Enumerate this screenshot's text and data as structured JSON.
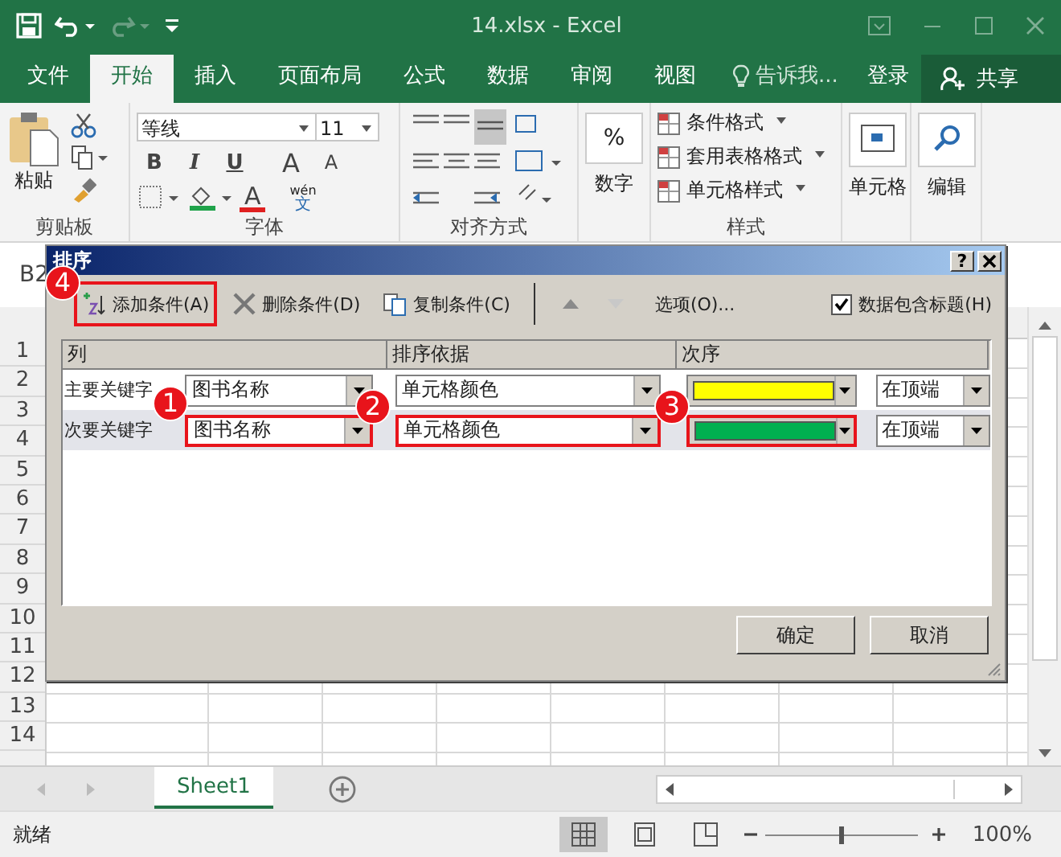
{
  "window": {
    "title": "14.xlsx - Excel"
  },
  "tabs": [
    {
      "label": "文件",
      "selected": false
    },
    {
      "label": "开始",
      "selected": true
    },
    {
      "label": "插入",
      "selected": false
    },
    {
      "label": "页面布局",
      "selected": false
    },
    {
      "label": "公式",
      "selected": false
    },
    {
      "label": "数据",
      "selected": false
    },
    {
      "label": "审阅",
      "selected": false
    },
    {
      "label": "视图",
      "selected": false
    }
  ],
  "tell_me": "告诉我...",
  "sign_in": "登录",
  "share": "共享",
  "ribbon": [
    {
      "kind": "clipboard",
      "label": "剪贴板",
      "paste": "粘贴"
    },
    {
      "kind": "font",
      "label": "字体",
      "font_name": "等线",
      "font_size": "11",
      "styles": [
        "B",
        "I",
        "U"
      ],
      "grow": "A",
      "shrink": "A",
      "font_color": "A",
      "phonetic": "wén",
      "phonetic_char": "文"
    },
    {
      "kind": "alignment",
      "label": "对齐方式"
    },
    {
      "kind": "number",
      "symbol": "%",
      "button": "数字"
    },
    {
      "kind": "styles",
      "label": "样式",
      "items": [
        "条件格式",
        "套用表格格式",
        "单元格样式"
      ]
    },
    {
      "kind": "cells",
      "button": "单元格"
    },
    {
      "kind": "editing",
      "button": "编辑"
    }
  ],
  "name_box": "B2",
  "row_numbers": [
    "1",
    "2",
    "3",
    "4",
    "5",
    "6",
    "7",
    "8",
    "9",
    "10",
    "11",
    "12",
    "13",
    "14"
  ],
  "sheet_tabs": [
    {
      "label": "Sheet1",
      "selected": true
    }
  ],
  "status_bar": {
    "text": "就绪",
    "zoom": "100%",
    "level": 0.5
  },
  "dialog": {
    "title": "排序",
    "help": "?",
    "toolbar": [
      {
        "kind": "add",
        "label": "添加条件(A)",
        "highlighted": true
      },
      {
        "kind": "delete",
        "label": "删除条件(D)",
        "highlighted": false
      },
      {
        "kind": "copy",
        "label": "复制条件(C)",
        "highlighted": false
      }
    ],
    "arrows": [
      {
        "kind": "up",
        "disabled": false
      },
      {
        "kind": "down",
        "disabled": true
      }
    ],
    "options": "选项(O)...",
    "header_checkbox": {
      "label": "数据包含标题(H)",
      "checked": true
    },
    "columns": [
      "列",
      "排序依据",
      "次序"
    ],
    "rows": [
      {
        "label": "主要关键字",
        "column": "图书名称",
        "sort_on": "单元格颜色",
        "color": "#ffff00",
        "order": "在顶端",
        "selected": false,
        "highlighted": false
      },
      {
        "label": "次要关键字",
        "column": "图书名称",
        "sort_on": "单元格颜色",
        "color": "#00b050",
        "order": "在顶端",
        "selected": true,
        "highlighted": true
      }
    ],
    "buttons": [
      "确定",
      "取消"
    ]
  },
  "callouts": [
    "4",
    "1",
    "2",
    "3"
  ]
}
